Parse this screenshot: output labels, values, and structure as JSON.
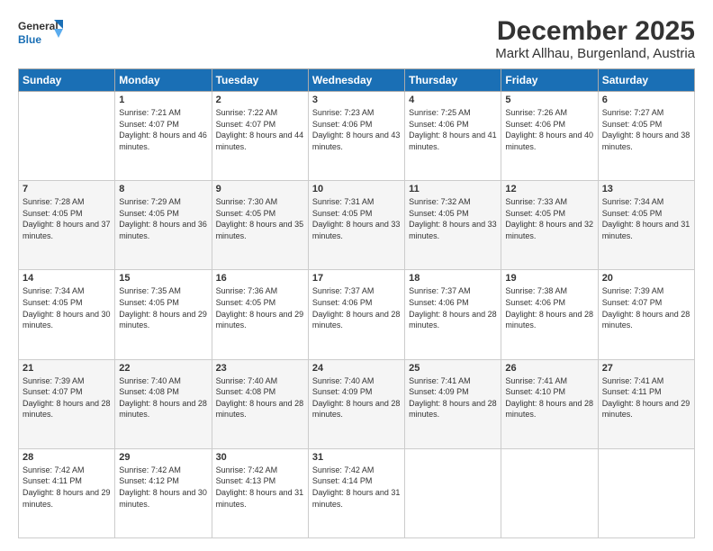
{
  "logo": {
    "line1": "General",
    "line2": "Blue"
  },
  "header": {
    "month": "December 2025",
    "location": "Markt Allhau, Burgenland, Austria"
  },
  "weekdays": [
    "Sunday",
    "Monday",
    "Tuesday",
    "Wednesday",
    "Thursday",
    "Friday",
    "Saturday"
  ],
  "weeks": [
    [
      {
        "day": "",
        "sunrise": "",
        "sunset": "",
        "daylight": ""
      },
      {
        "day": "1",
        "sunrise": "7:21 AM",
        "sunset": "4:07 PM",
        "daylight": "8 hours and 46 minutes."
      },
      {
        "day": "2",
        "sunrise": "7:22 AM",
        "sunset": "4:07 PM",
        "daylight": "8 hours and 44 minutes."
      },
      {
        "day": "3",
        "sunrise": "7:23 AM",
        "sunset": "4:06 PM",
        "daylight": "8 hours and 43 minutes."
      },
      {
        "day": "4",
        "sunrise": "7:25 AM",
        "sunset": "4:06 PM",
        "daylight": "8 hours and 41 minutes."
      },
      {
        "day": "5",
        "sunrise": "7:26 AM",
        "sunset": "4:06 PM",
        "daylight": "8 hours and 40 minutes."
      },
      {
        "day": "6",
        "sunrise": "7:27 AM",
        "sunset": "4:05 PM",
        "daylight": "8 hours and 38 minutes."
      }
    ],
    [
      {
        "day": "7",
        "sunrise": "7:28 AM",
        "sunset": "4:05 PM",
        "daylight": "8 hours and 37 minutes."
      },
      {
        "day": "8",
        "sunrise": "7:29 AM",
        "sunset": "4:05 PM",
        "daylight": "8 hours and 36 minutes."
      },
      {
        "day": "9",
        "sunrise": "7:30 AM",
        "sunset": "4:05 PM",
        "daylight": "8 hours and 35 minutes."
      },
      {
        "day": "10",
        "sunrise": "7:31 AM",
        "sunset": "4:05 PM",
        "daylight": "8 hours and 33 minutes."
      },
      {
        "day": "11",
        "sunrise": "7:32 AM",
        "sunset": "4:05 PM",
        "daylight": "8 hours and 33 minutes."
      },
      {
        "day": "12",
        "sunrise": "7:33 AM",
        "sunset": "4:05 PM",
        "daylight": "8 hours and 32 minutes."
      },
      {
        "day": "13",
        "sunrise": "7:34 AM",
        "sunset": "4:05 PM",
        "daylight": "8 hours and 31 minutes."
      }
    ],
    [
      {
        "day": "14",
        "sunrise": "7:34 AM",
        "sunset": "4:05 PM",
        "daylight": "8 hours and 30 minutes."
      },
      {
        "day": "15",
        "sunrise": "7:35 AM",
        "sunset": "4:05 PM",
        "daylight": "8 hours and 29 minutes."
      },
      {
        "day": "16",
        "sunrise": "7:36 AM",
        "sunset": "4:05 PM",
        "daylight": "8 hours and 29 minutes."
      },
      {
        "day": "17",
        "sunrise": "7:37 AM",
        "sunset": "4:06 PM",
        "daylight": "8 hours and 28 minutes."
      },
      {
        "day": "18",
        "sunrise": "7:37 AM",
        "sunset": "4:06 PM",
        "daylight": "8 hours and 28 minutes."
      },
      {
        "day": "19",
        "sunrise": "7:38 AM",
        "sunset": "4:06 PM",
        "daylight": "8 hours and 28 minutes."
      },
      {
        "day": "20",
        "sunrise": "7:39 AM",
        "sunset": "4:07 PM",
        "daylight": "8 hours and 28 minutes."
      }
    ],
    [
      {
        "day": "21",
        "sunrise": "7:39 AM",
        "sunset": "4:07 PM",
        "daylight": "8 hours and 28 minutes."
      },
      {
        "day": "22",
        "sunrise": "7:40 AM",
        "sunset": "4:08 PM",
        "daylight": "8 hours and 28 minutes."
      },
      {
        "day": "23",
        "sunrise": "7:40 AM",
        "sunset": "4:08 PM",
        "daylight": "8 hours and 28 minutes."
      },
      {
        "day": "24",
        "sunrise": "7:40 AM",
        "sunset": "4:09 PM",
        "daylight": "8 hours and 28 minutes."
      },
      {
        "day": "25",
        "sunrise": "7:41 AM",
        "sunset": "4:09 PM",
        "daylight": "8 hours and 28 minutes."
      },
      {
        "day": "26",
        "sunrise": "7:41 AM",
        "sunset": "4:10 PM",
        "daylight": "8 hours and 28 minutes."
      },
      {
        "day": "27",
        "sunrise": "7:41 AM",
        "sunset": "4:11 PM",
        "daylight": "8 hours and 29 minutes."
      }
    ],
    [
      {
        "day": "28",
        "sunrise": "7:42 AM",
        "sunset": "4:11 PM",
        "daylight": "8 hours and 29 minutes."
      },
      {
        "day": "29",
        "sunrise": "7:42 AM",
        "sunset": "4:12 PM",
        "daylight": "8 hours and 30 minutes."
      },
      {
        "day": "30",
        "sunrise": "7:42 AM",
        "sunset": "4:13 PM",
        "daylight": "8 hours and 31 minutes."
      },
      {
        "day": "31",
        "sunrise": "7:42 AM",
        "sunset": "4:14 PM",
        "daylight": "8 hours and 31 minutes."
      },
      {
        "day": "",
        "sunrise": "",
        "sunset": "",
        "daylight": ""
      },
      {
        "day": "",
        "sunrise": "",
        "sunset": "",
        "daylight": ""
      },
      {
        "day": "",
        "sunrise": "",
        "sunset": "",
        "daylight": ""
      }
    ]
  ]
}
